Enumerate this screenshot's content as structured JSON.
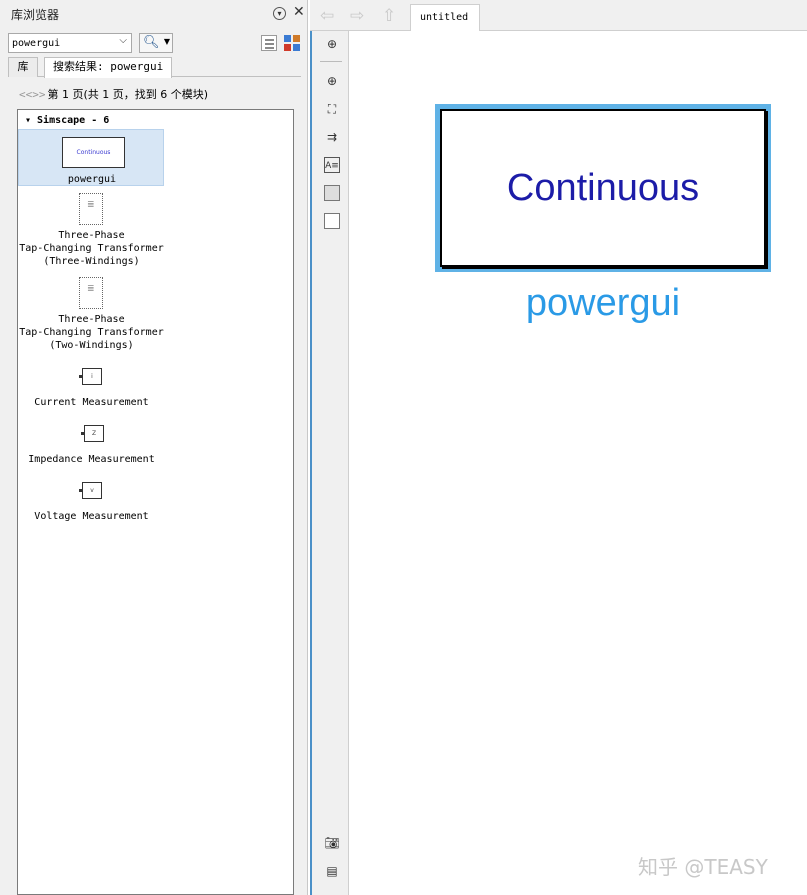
{
  "library_browser": {
    "title": "库浏览器",
    "menu_icon": "chevron-circle-down-icon",
    "close_icon": "close-icon",
    "search_value": "powergui",
    "tabs": [
      {
        "label": "库"
      },
      {
        "label": "搜索结果: powergui"
      }
    ],
    "pager_arrows": "<<>>",
    "pager_text": "第 1 页(共 1 页，找到 6 个模块)",
    "group_header": "▾ Simscape - 6",
    "blocks": [
      {
        "label": "powergui",
        "thumb_text": "Continuous",
        "selected": true
      },
      {
        "label": "Three-Phase\nTap-Changing Transformer\n(Three-Windings)"
      },
      {
        "label": "Three-Phase\nTap-Changing Transformer\n(Two-Windings)"
      },
      {
        "label": "Current Measurement",
        "thumb_text": "i"
      },
      {
        "label": "Impedance Measurement",
        "thumb_text": "Z"
      },
      {
        "label": "Voltage Measurement",
        "thumb_text": "v"
      }
    ]
  },
  "editor": {
    "tab_label": "untitled",
    "nav_icons": [
      "back-arrow-icon",
      "forward-arrow-icon",
      "up-arrow-icon"
    ],
    "side_tools": [
      "navigate-icon",
      "zoom-icon",
      "fit-view-icon",
      "arrow-icon",
      "annotation-icon",
      "image-icon",
      "area-icon",
      "screenshot-icon",
      "property-icon"
    ],
    "block": {
      "text": "Continuous",
      "name": "powergui"
    }
  },
  "colors": {
    "selection_blue": "#5fb2e6",
    "block_text": "#1c1ca8",
    "block_name": "#2a9ae6"
  },
  "watermark": "知乎 @TEASY"
}
